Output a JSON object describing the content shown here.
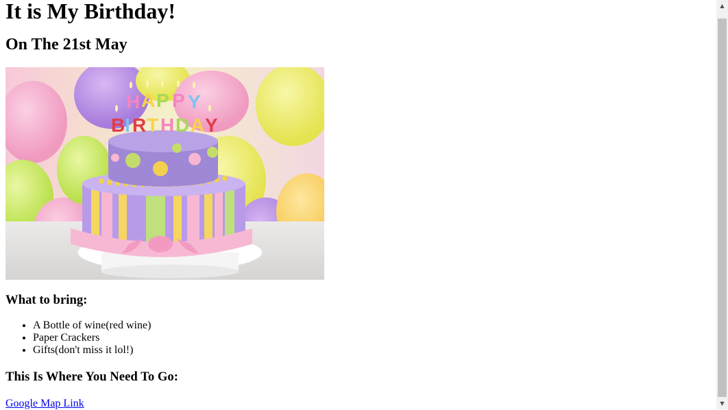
{
  "page": {
    "title": "It is My Birthday!",
    "date": "On The 21st May",
    "hero_image": "birthday-cake-with-happy-birthday-candles-and-balloons",
    "bring_heading": "What to bring:",
    "bring_items": [
      "A Bottle of wine(red wine)",
      "Paper Crackers",
      "Gifts(don't miss it lol!)"
    ],
    "where_heading": "This Is Where You Need To Go:",
    "map_link": "Google Map Link"
  },
  "colors": {
    "link": "#0000ee",
    "scrollbar_track": "#f1f1f1",
    "scrollbar_thumb": "#c1c1c1"
  },
  "scrollbar": {
    "up_icon": "▲",
    "down_icon": "▼"
  }
}
